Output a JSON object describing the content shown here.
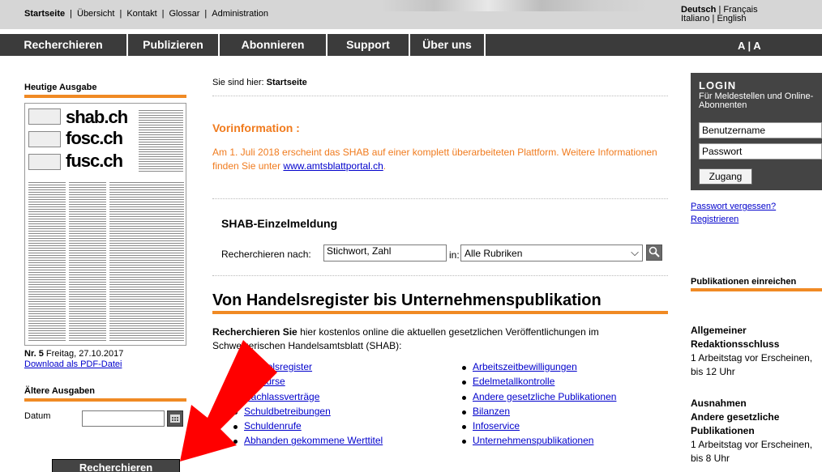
{
  "topnav": {
    "items": [
      "Startseite",
      "Übersicht",
      "Kontakt",
      "Glossar",
      "Administration"
    ],
    "languages_row1": [
      "Deutsch",
      "Français"
    ],
    "languages_row2": [
      "Italiano",
      "English"
    ]
  },
  "mainnav": {
    "items": [
      "Recherchieren",
      "Publizieren",
      "Abonnieren",
      "Support",
      "Über uns"
    ],
    "fontsize_label": "A | A"
  },
  "left": {
    "today_heading": "Heutige Ausgabe",
    "cover_titles": [
      "shab.ch",
      "fosc.ch",
      "fusc.ch"
    ],
    "issue_number": "Nr. 5",
    "issue_date": "Freitag, 27.10.2017",
    "download_link": "Download als PDF-Datei",
    "older_heading": "Ältere Ausgaben",
    "datum_label": "Datum",
    "datum_value": "",
    "submit_label": "Recherchieren"
  },
  "main": {
    "breadcrumb_prefix": "Sie sind hier:",
    "breadcrumb_current": "Startseite",
    "vorinfo_title": "Vorinformation :",
    "vorinfo_text": "Am 1. Juli 2018 erscheint das SHAB auf einer komplett überarbeiteten Plattform. Weitere Informationen finden Sie unter",
    "vorinfo_link": "www.amtsblattportal.ch",
    "search_title": "SHAB-Einzelmeldung",
    "search_label": "Recherchieren nach:",
    "search_value": "Stichwort, Zahl",
    "in_label": "in:",
    "rubrik_selected": "Alle Rubriken",
    "section_title": "Von Handelsregister bis Unternehmenspublikation",
    "intro_bold": "Recherchieren Sie",
    "intro_text": "hier kostenlos online die aktuellen gesetzlichen Veröffentlichungen im Schweizerischen Handelsamtsblatt (SHAB):",
    "links_left": [
      "Handelsregister",
      "Konkurse",
      "Nachlassverträge",
      "Schuldbetreibungen",
      "Schuldenrufe",
      "Abhanden gekommene Werttitel"
    ],
    "links_right": [
      "Arbeitszeitbewilligungen",
      "Edelmetallkontrolle",
      "Andere gesetzliche Publikationen",
      "Bilanzen",
      "Infoservice",
      "Unternehmenspublikationen"
    ]
  },
  "right": {
    "login_title": "LOGIN",
    "login_subtitle": "Für Meldestellen und Online-Abonnenten",
    "username_placeholder": "Benutzername",
    "password_placeholder": "Passwort",
    "login_button": "Zugang",
    "forgot_link": "Passwort vergessen?",
    "register_link": "Registrieren",
    "submit_heading": "Publikationen einreichen",
    "deadline_heading1": "Allgemeiner",
    "deadline_heading2": "Redaktionsschluss",
    "deadline_text": "1 Arbeitstag vor Erscheinen, bis 12 Uhr",
    "exceptions_heading1": "Ausnahmen",
    "exceptions_heading2": "Andere gesetzliche Publikationen",
    "exceptions_text": "1 Arbeitstag vor Erscheinen, bis 8 Uhr"
  },
  "colors": {
    "accent": "#f08a24",
    "nav_bg": "#3b3b3b",
    "arrow": "#ff0000"
  }
}
